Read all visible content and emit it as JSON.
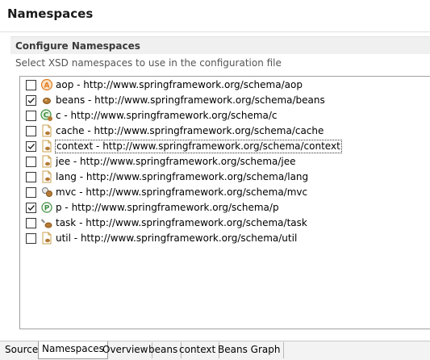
{
  "header": {
    "title": "Namespaces"
  },
  "section": {
    "title": "Configure Namespaces",
    "description": "Select XSD namespaces to use in the configuration file"
  },
  "namespaces": [
    {
      "label": "aop - http://www.springframework.org/schema/aop",
      "checked": false,
      "icon": "aop-icon"
    },
    {
      "label": "beans - http://www.springframework.org/schema/beans",
      "checked": true,
      "icon": "bean-icon"
    },
    {
      "label": "c - http://www.springframework.org/schema/c",
      "checked": false,
      "icon": "c-namespace-icon"
    },
    {
      "label": "cache - http://www.springframework.org/schema/cache",
      "checked": false,
      "icon": "cache-icon"
    },
    {
      "label": "context - http://www.springframework.org/schema/context",
      "checked": true,
      "icon": "context-icon",
      "selected": true
    },
    {
      "label": "jee - http://www.springframework.org/schema/jee",
      "checked": false,
      "icon": "jee-icon"
    },
    {
      "label": "lang - http://www.springframework.org/schema/lang",
      "checked": false,
      "icon": "lang-icon"
    },
    {
      "label": "mvc - http://www.springframework.org/schema/mvc",
      "checked": false,
      "icon": "mvc-icon"
    },
    {
      "label": "p - http://www.springframework.org/schema/p",
      "checked": true,
      "icon": "p-namespace-icon"
    },
    {
      "label": "task - http://www.springframework.org/schema/task",
      "checked": false,
      "icon": "task-icon"
    },
    {
      "label": "util - http://www.springframework.org/schema/util",
      "checked": false,
      "icon": "util-icon"
    }
  ],
  "tabs": [
    {
      "label": "Source",
      "active": false
    },
    {
      "label": "Namespaces",
      "active": true
    },
    {
      "label": "Overview",
      "active": false
    },
    {
      "label": "beans",
      "active": false
    },
    {
      "label": "context",
      "active": false
    },
    {
      "label": "Beans Graph",
      "active": false
    }
  ],
  "colors": {
    "aop": "#e07b20",
    "bean": "#8a5a1e",
    "green": "#3c8c3c",
    "doc": "#c9a050"
  }
}
